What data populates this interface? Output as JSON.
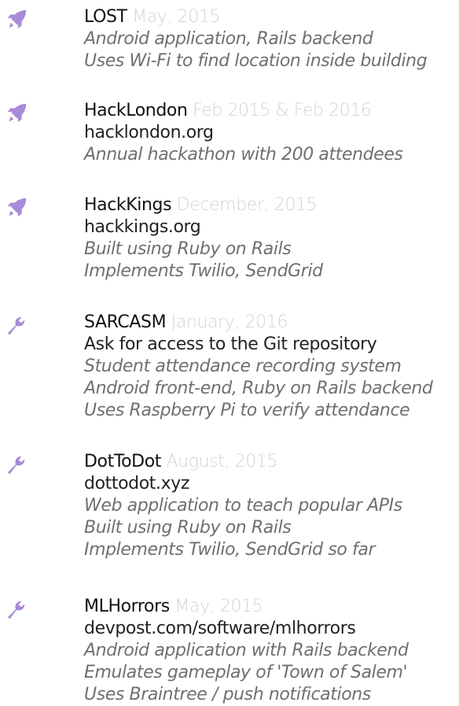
{
  "colors": {
    "icon_purple": "#a88ad8",
    "date_gray": "#d3d3d3",
    "desc_gray": "#6f6f6f"
  },
  "projects": [
    {
      "icon": "rocket-icon",
      "name": "LOST",
      "date": "May, 2015",
      "link": "",
      "details": [
        "Android application, Rails backend",
        "Uses Wi-Fi to find location inside building"
      ]
    },
    {
      "icon": "rocket-icon",
      "name": "HackLondon",
      "date": "Feb 2015 & Feb 2016",
      "link": "hacklondon.org",
      "details": [
        "Annual hackathon with 200 attendees"
      ]
    },
    {
      "icon": "rocket-icon",
      "name": "HackKings",
      "date": "December, 2015",
      "link": "hackkings.org",
      "details": [
        "Built using Ruby on Rails",
        "Implements Twilio, SendGrid"
      ]
    },
    {
      "icon": "wrench-icon",
      "name": "SARCASM",
      "date": "January, 2016",
      "link": "Ask for access to the Git repository",
      "details": [
        "Student attendance recording system",
        "Android front-end, Ruby on Rails backend",
        "Uses Raspberry Pi to verify attendance"
      ]
    },
    {
      "icon": "wrench-icon",
      "name": "DotToDot",
      "date": "August, 2015",
      "link": "dottodot.xyz",
      "details": [
        "Web application to teach popular APIs",
        "Built using Ruby on Rails",
        "Implements Twilio, SendGrid so far"
      ]
    },
    {
      "icon": "wrench-icon",
      "name": "MLHorrors",
      "date": "May, 2015",
      "link": "devpost.com/software/mlhorrors",
      "details": [
        "Android application with Rails backend",
        "Emulates gameplay of 'Town of Salem'",
        "Uses Braintree / push notifications"
      ]
    }
  ]
}
